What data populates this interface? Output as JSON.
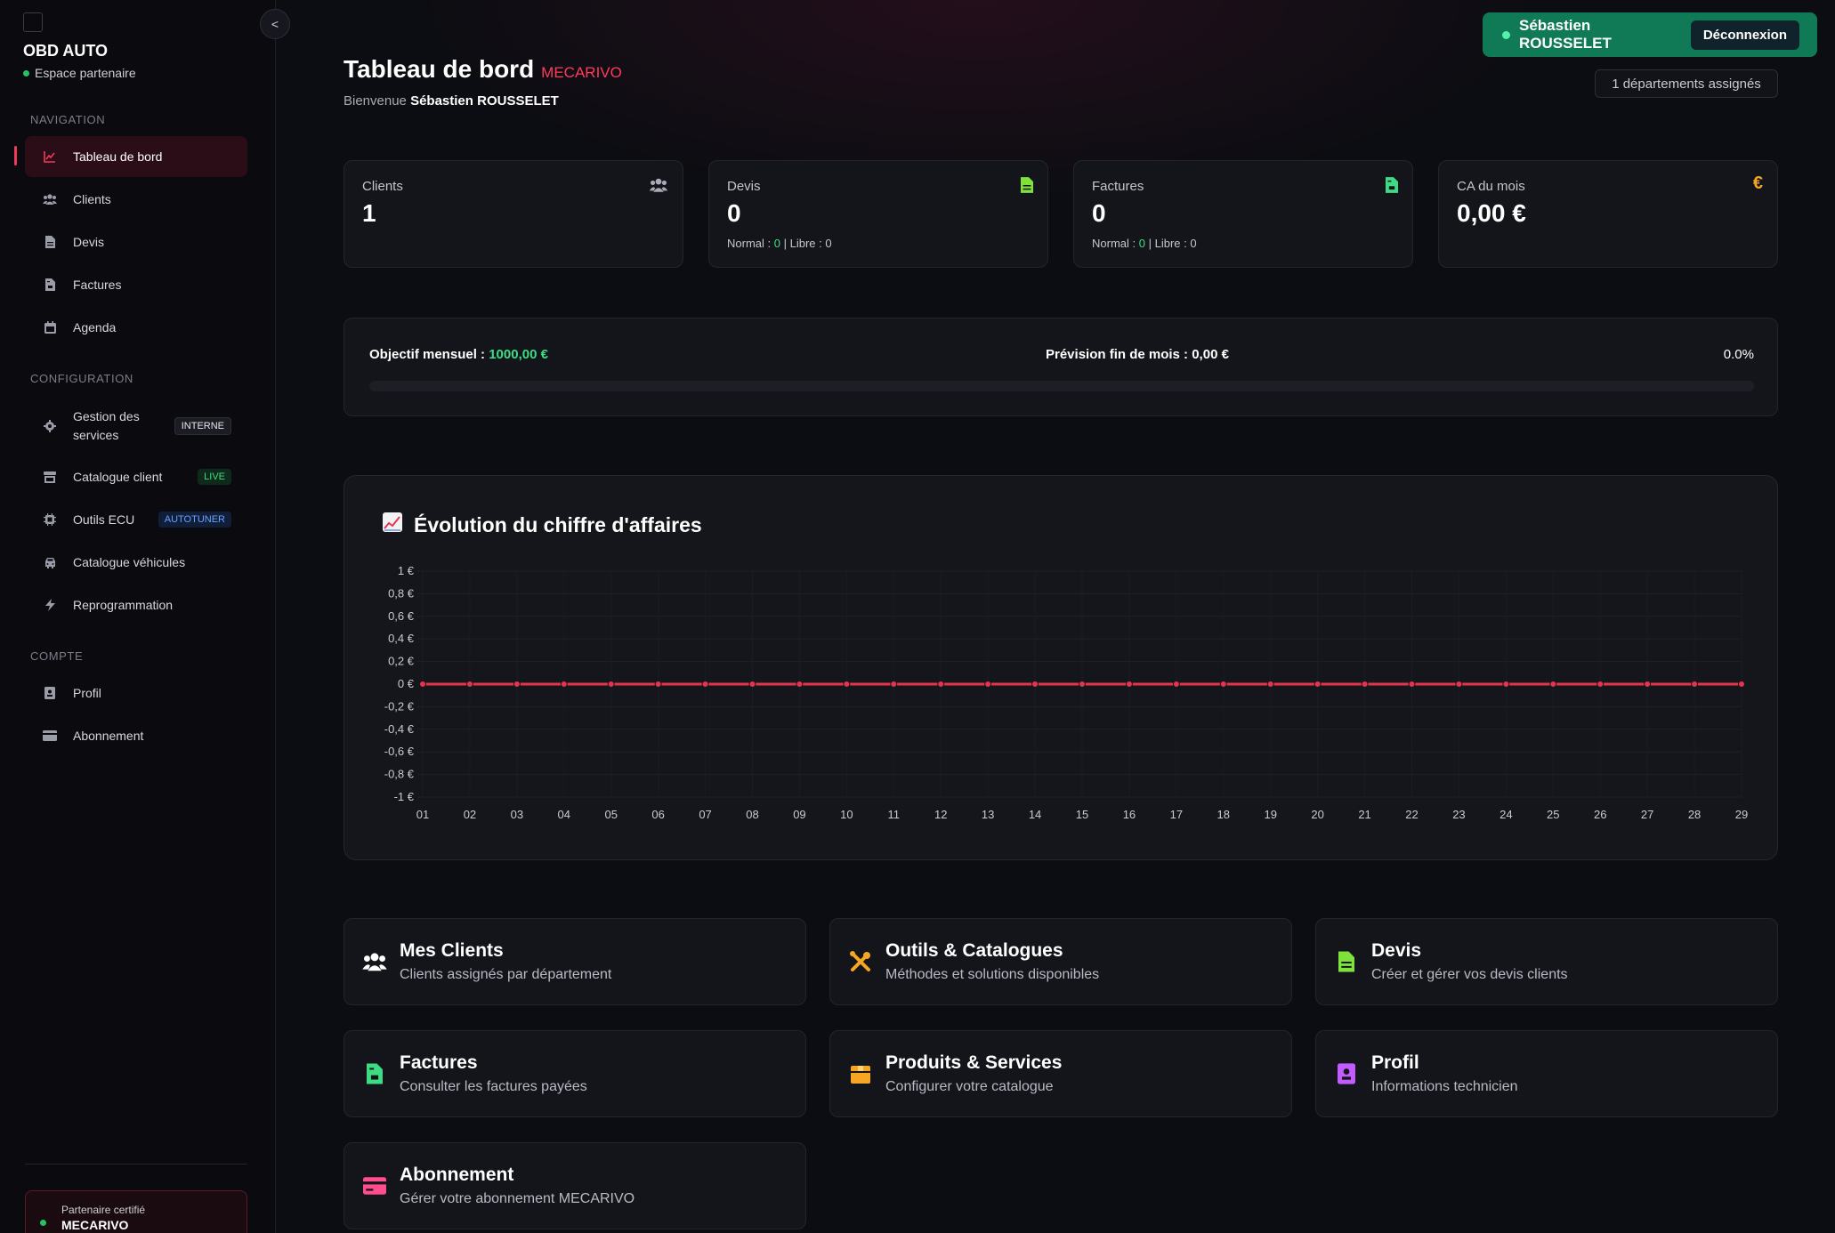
{
  "sidebar": {
    "brand": "OBD AUTO",
    "brand_sub": "Espace partenaire",
    "collapse_label": "<",
    "sections": {
      "navigation": "NAVIGATION",
      "configuration": "CONFIGURATION",
      "compte": "COMPTE"
    },
    "items": [
      {
        "label": "Tableau de bord",
        "icon": "chart-line-icon",
        "active": true
      },
      {
        "label": "Clients",
        "icon": "users-icon"
      },
      {
        "label": "Devis",
        "icon": "file-icon"
      },
      {
        "label": "Factures",
        "icon": "invoice-icon"
      },
      {
        "label": "Agenda",
        "icon": "calendar-icon"
      },
      {
        "label": "Gestion des services",
        "icon": "gear-icon",
        "badge": "INTERNE"
      },
      {
        "label": "Catalogue client",
        "icon": "store-icon",
        "badge": "LIVE"
      },
      {
        "label": "Outils ECU",
        "icon": "cpu-icon",
        "badge": "AUTOTUNER"
      },
      {
        "label": "Catalogue véhicules",
        "icon": "car-icon"
      },
      {
        "label": "Reprogrammation",
        "icon": "bolt-icon"
      },
      {
        "label": "Profil",
        "icon": "id-badge-icon"
      },
      {
        "label": "Abonnement",
        "icon": "credit-card-icon"
      }
    ],
    "partner": {
      "small": "Partenaire certifié",
      "big": "MECARIVO"
    }
  },
  "header": {
    "user_name": "Sébastien ROUSSELET",
    "logout_label": "Déconnexion",
    "departments": "1 départements assignés",
    "title": "Tableau de bord",
    "title_brand": "MECARIVO",
    "welcome_prefix": "Bienvenue",
    "welcome_name": "Sébastien ROUSSELET"
  },
  "stats": [
    {
      "label": "Clients",
      "value": "1",
      "icon": "users-icon",
      "icon_color": "#a9acb8"
    },
    {
      "label": "Devis",
      "value": "0",
      "normal_label": "Normal :",
      "normal_value": "0",
      "libre_label": "| Libre :",
      "libre_value": "0",
      "icon": "file-icon",
      "icon_color": "#7ee23a"
    },
    {
      "label": "Factures",
      "value": "0",
      "normal_label": "Normal :",
      "normal_value": "0",
      "libre_label": "| Libre :",
      "libre_value": "0",
      "icon": "invoice-icon",
      "icon_color": "#3ddc84"
    },
    {
      "label": "CA du mois",
      "value": "0,00 €",
      "icon": "euro-icon",
      "icon_color": "#f5a623"
    }
  ],
  "objective": {
    "label": "Objectif mensuel :",
    "value": "1000,00 €",
    "forecast_label": "Prévision fin de mois :",
    "forecast_value": "0,00 €",
    "percent": "0.0%",
    "progress": 0
  },
  "chart": {
    "title": "Évolution du chiffre d'affaires",
    "icon": "chart-emoji-icon"
  },
  "chart_data": {
    "type": "line",
    "title": "Évolution du chiffre d'affaires",
    "xlabel": "",
    "ylabel": "",
    "ylim": [
      -1,
      1
    ],
    "yticks": [
      "1 €",
      "0,8 €",
      "0,6 €",
      "0,4 €",
      "0,2 €",
      "0 €",
      "-0,2 €",
      "-0,4 €",
      "-0,6 €",
      "-0,8 €",
      "-1 €"
    ],
    "ytick_values": [
      1,
      0.8,
      0.6,
      0.4,
      0.2,
      0,
      -0.2,
      -0.4,
      -0.6,
      -0.8,
      -1
    ],
    "categories": [
      "01",
      "02",
      "03",
      "04",
      "05",
      "06",
      "07",
      "08",
      "09",
      "10",
      "11",
      "12",
      "13",
      "14",
      "15",
      "16",
      "17",
      "18",
      "19",
      "20",
      "21",
      "22",
      "23",
      "24",
      "25",
      "26",
      "27",
      "28",
      "29"
    ],
    "series": [
      {
        "values": [
          0,
          0,
          0,
          0,
          0,
          0,
          0,
          0,
          0,
          0,
          0,
          0,
          0,
          0,
          0,
          0,
          0,
          0,
          0,
          0,
          0,
          0,
          0,
          0,
          0,
          0,
          0,
          0,
          0
        ],
        "color": "#e6344f"
      }
    ],
    "grid": true
  },
  "tiles": [
    {
      "title": "Mes Clients",
      "desc": "Clients assignés par département",
      "icon": "users-icon",
      "color": "#ffffff"
    },
    {
      "title": "Outils & Catalogues",
      "desc": "Méthodes et solutions disponibles",
      "icon": "tools-icon",
      "color": "#f5a623"
    },
    {
      "title": "Devis",
      "desc": "Créer et gérer vos devis clients",
      "icon": "file-icon",
      "color": "#7ee23a"
    },
    {
      "title": "Factures",
      "desc": "Consulter les factures payées",
      "icon": "invoice-icon",
      "color": "#3ddc84"
    },
    {
      "title": "Produits & Services",
      "desc": "Configurer votre catalogue",
      "icon": "box-icon",
      "color": "#f5a623"
    },
    {
      "title": "Profil",
      "desc": "Informations technicien",
      "icon": "id-badge-icon",
      "color": "#c35cff"
    },
    {
      "title": "Abonnement",
      "desc": "Gérer votre abonnement MECARIVO",
      "icon": "credit-card-icon",
      "color": "#ff4d8d"
    }
  ]
}
